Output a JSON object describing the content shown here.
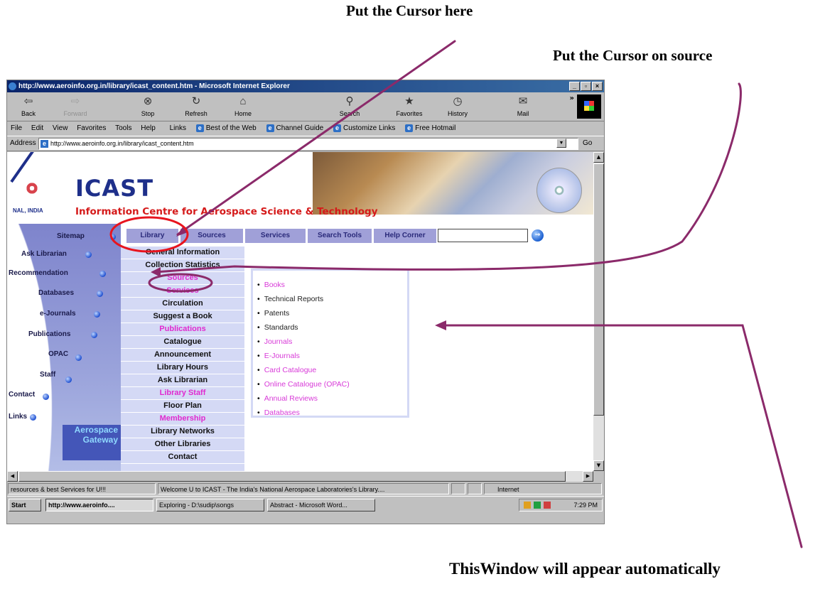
{
  "captions": {
    "cursor_here": "Put the Cursor here",
    "cursor_source": "Put the Cursor on source",
    "window_appear": "ThisWindow will appear automatically"
  },
  "browser": {
    "title": "http://www.aeroinfo.org.in/library/icast_content.htm - Microsoft Internet Explorer",
    "window_buttons": [
      "_",
      "▫",
      "×"
    ],
    "toolbar": [
      {
        "label": "Back",
        "icon": "back-arrow-icon",
        "glyph": "⇦"
      },
      {
        "label": "Forward",
        "icon": "forward-arrow-icon",
        "glyph": "⇨"
      },
      {
        "label": "Stop",
        "icon": "stop-icon",
        "glyph": "⊗"
      },
      {
        "label": "Refresh",
        "icon": "refresh-icon",
        "glyph": "↻"
      },
      {
        "label": "Home",
        "icon": "home-icon",
        "glyph": "⌂"
      },
      {
        "label": "Search",
        "icon": "search-icon",
        "glyph": "⚲"
      },
      {
        "label": "Favorites",
        "icon": "favorites-icon",
        "glyph": "★"
      },
      {
        "label": "History",
        "icon": "history-icon",
        "glyph": "◷"
      },
      {
        "label": "Mail",
        "icon": "mail-icon",
        "glyph": "✉"
      }
    ],
    "menu": [
      "File",
      "Edit",
      "View",
      "Favorites",
      "Tools",
      "Help"
    ],
    "links_label": "Links",
    "links": [
      "Best of the Web",
      "Channel Guide",
      "Customize Links",
      "Free Hotmail"
    ],
    "address_label": "Address",
    "address": "http://www.aeroinfo.org.in/library/icast_content.htm",
    "go_label": "Go",
    "status": {
      "left": "resources & best Services for U!!!",
      "middle": "Welcome U to ICAST - The India's National Aerospace Laboratories's Library....",
      "zone": "Internet"
    },
    "taskbar": {
      "start": "Start",
      "buttons": [
        "http://www.aeroinfo....",
        "Exploring - D:\\sudip\\songs",
        "Abstract - Microsoft Word..."
      ],
      "clock": "7:29 PM"
    }
  },
  "page": {
    "logo_sub": "NAL, INDIA",
    "title": "ICAST",
    "subtitle": "Information Centre for Aerospace Science & Technology",
    "leftnav": [
      "Sitemap",
      "Ask Librarian",
      "Recommendation",
      "Databases",
      "e-Journals",
      "Publications",
      "OPAC",
      "Staff",
      "Contact",
      "Links"
    ],
    "gateway": [
      "Aerospace",
      "Gateway"
    ],
    "tabs": [
      "Library",
      "Sources",
      "Services",
      "Search Tools",
      "Help Corner"
    ],
    "submenu": [
      {
        "label": "General Information",
        "color": "black"
      },
      {
        "label": "Collection Statistics",
        "color": "black"
      },
      {
        "label": "Sources",
        "color": "pink"
      },
      {
        "label": "Services",
        "color": "pink"
      },
      {
        "label": "Circulation",
        "color": "black"
      },
      {
        "label": "Suggest a Book",
        "color": "black"
      },
      {
        "label": "Publications",
        "color": "pink"
      },
      {
        "label": "Catalogue",
        "color": "black"
      },
      {
        "label": "Announcement",
        "color": "black"
      },
      {
        "label": "Library Hours",
        "color": "black"
      },
      {
        "label": "Ask Librarian",
        "color": "black"
      },
      {
        "label": "Library Staff",
        "color": "pink"
      },
      {
        "label": "Floor Plan",
        "color": "black"
      },
      {
        "label": "Membership",
        "color": "pink"
      },
      {
        "label": "Library Networks",
        "color": "black"
      },
      {
        "label": "Other Libraries",
        "color": "black"
      },
      {
        "label": "Contact",
        "color": "black"
      }
    ],
    "popup": [
      {
        "label": "Books",
        "color": "pink"
      },
      {
        "label": "Technical Reports",
        "color": "black"
      },
      {
        "label": "Patents",
        "color": "black"
      },
      {
        "label": "Standards",
        "color": "black"
      },
      {
        "label": "Journals",
        "color": "pink"
      },
      {
        "label": "E-Journals",
        "color": "pink"
      },
      {
        "label": "Card Catalogue",
        "color": "pink"
      },
      {
        "label": "Online Catalogue (OPAC)",
        "color": "pink"
      },
      {
        "label": "Annual Reviews",
        "color": "pink"
      },
      {
        "label": "Databases",
        "color": "pink"
      }
    ]
  },
  "colors": {
    "annotation": "#8b2a6a",
    "highlight_red": "#e8141e",
    "accent_pink": "#e02ad0"
  }
}
